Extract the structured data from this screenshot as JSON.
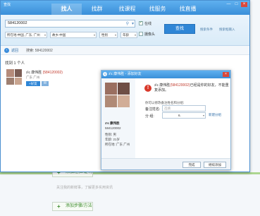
{
  "window": {
    "title": "查找",
    "tabs": [
      {
        "label": "找人",
        "active": true
      },
      {
        "label": "找群",
        "active": false
      },
      {
        "label": "找课程",
        "active": false
      },
      {
        "label": "找服务",
        "active": false
      },
      {
        "label": "找直播",
        "active": false
      }
    ],
    "controls": {
      "minimize": "—",
      "maximize": "□",
      "close": "×"
    }
  },
  "search": {
    "keyword": "584120002",
    "online_label": "在线",
    "camera_label": "摄像头",
    "location_value": "所在地:中国, 广东, 广州",
    "hometown_value": "故乡:中国",
    "gender_value": "性别",
    "age_value": "年龄",
    "find_button": "查找",
    "hints": [
      "搜索条件",
      "搜索框输入"
    ]
  },
  "nav": {
    "back_label": "返回",
    "breadcrumb": "搜索: 584120002"
  },
  "results": {
    "count_text": "找到 1 个人",
    "items": [
      {
        "name": "з'є 康伟胜",
        "id": "(584120002)",
        "location": "广东 广州",
        "add_label": "+好友",
        "msg_label": "✉"
      }
    ]
  },
  "dialog": {
    "title": "з'є 康伟胜 - 添加好友",
    "close": "×",
    "profile": {
      "name": "з'є 康伟胜",
      "id": "584120002",
      "gender": "性别: 男",
      "age": "年龄: 21岁",
      "location": "所在地: 广东 广州"
    },
    "warning_name": "з'є 康伟胜",
    "warning_id": "(584120002)",
    "warning_rest": "已经是你的好友，不能重复添加。",
    "tip": "你可以修改备注姓名和分组:",
    "remark_label": "备注姓名:",
    "remark_placeholder": "选填",
    "group_label": "分    组:",
    "group_value": "6.",
    "new_group_link": "新建分组",
    "buttons": {
      "done": "完成",
      "continue": "继续添加"
    }
  },
  "background": {
    "add_experience": "添加经验/证明",
    "hint_line": "关注我的新鲜事，了解更多实用资讯",
    "add_steps": "添加步骤/方法"
  }
}
